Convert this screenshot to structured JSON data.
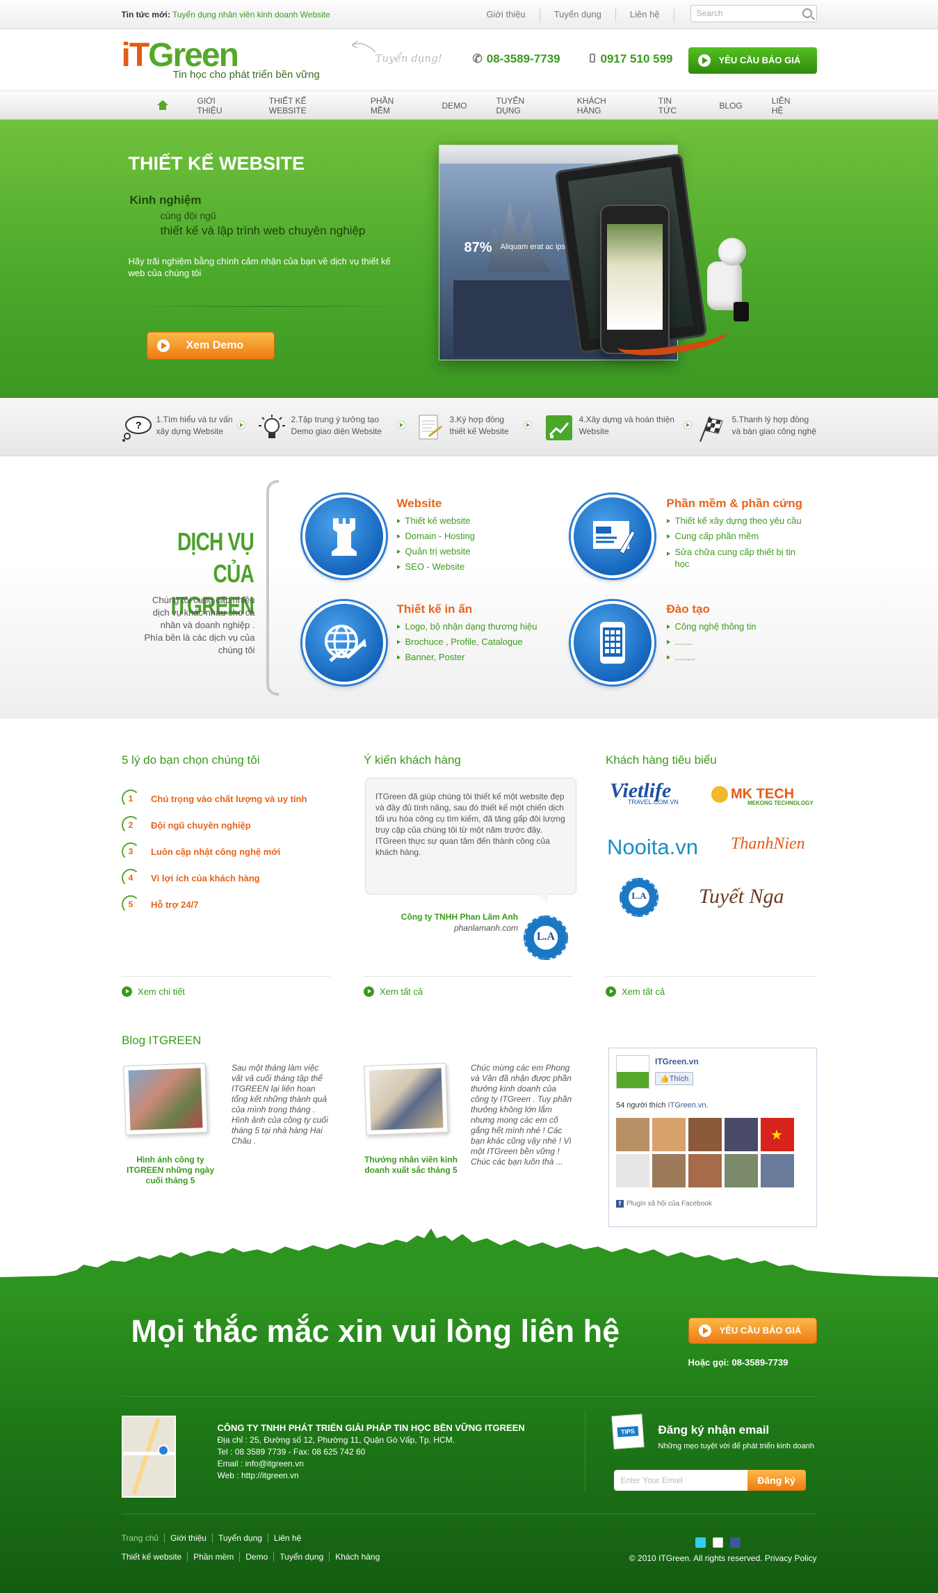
{
  "topbar": {
    "news_prefix": "Tin tức mới:",
    "news_link": "Tuyển dụng nhân viên kinh doanh Website",
    "links": [
      "Giới thiệu",
      "Tuyển dụng",
      "Liên hệ"
    ],
    "search_placeholder": "Search"
  },
  "header": {
    "logo_text_a": "iT",
    "logo_text_b": "Green",
    "tagline": "Tin học cho phát triển bền vững",
    "hand_note": "Tuyển dụng!",
    "phone1": "08-3589-7739",
    "phone2": "0917 510 599",
    "quote_button": "YÊU CẦU BÁO GIÁ"
  },
  "nav": {
    "items": [
      "GIỚI THIỆU",
      "THIẾT KẾ WEBSITE",
      "PHẦN MỀM",
      "DEMO",
      "TUYỂN DỤNG",
      "KHÁCH HÀNG",
      "TIN TỨC",
      "BLOG",
      "LIÊN HỆ"
    ]
  },
  "hero": {
    "title": "THIẾT KẾ WEBSITE",
    "line1": "Kinh nghiệm",
    "line2": "cùng đội ngũ",
    "line3": "thiết kế và lập trình web chuyên nghiệp",
    "paragraph": "Hãy trãi nghiệm bằng chính cảm nhận của bạn về dịch vụ thiết kế web của chúng tôi",
    "demo_button": "Xem Demo",
    "screen_stat": "87%",
    "screen_caption": "Aliquam erat ac ipsum."
  },
  "steps": [
    {
      "line1": "1.Tìm hiểu và tư vấn",
      "line2": "xây dựng Website"
    },
    {
      "line1": "2.Tập trung ý tưởng tạo",
      "line2": "Demo giao diện Website"
    },
    {
      "line1": "3.Ký hợp đồng",
      "line2": "thiết kế Website"
    },
    {
      "line1": "4.Xây dựng và hoàn thiện",
      "line2": "Website"
    },
    {
      "line1": "5.Thanh lý hợp đồng",
      "line2": "và bàn giao công nghệ"
    }
  ],
  "services": {
    "title_line1": "DỊCH VỤ CỦA",
    "title_line2": "ITGREEN",
    "description": "Chúng tôi cung cấp nhiều dịch vụ khác nhau cho cá nhân và doanh nghiệp . Phía bên là các dịch vụ của chúng tôi",
    "items": [
      {
        "title": "Website",
        "list": [
          "Thiết kế website",
          "Domain - Hosting",
          "Quản trị website",
          "SEO - Website"
        ]
      },
      {
        "title": "Phần mềm & phần cứng",
        "list": [
          "Thiết kế xây dựng theo yêu cầu",
          "Cung cấp phần mềm",
          "Sửa chữa cung cấp thiết bị tin học"
        ]
      },
      {
        "title": "Thiết kế in ấn",
        "list": [
          "Logo, bộ nhận dạng thương hiệu",
          "Brochuce , Profile, Catalogue",
          "Banner, Poster"
        ]
      },
      {
        "title": "Đào tạo",
        "list": [
          "Công nghệ thông tin",
          ".......",
          "........"
        ]
      }
    ]
  },
  "reasons": {
    "heading": "5 lý do bạn chọn chúng tôi",
    "items": [
      "Chú trọng vào chất lượng và uy tính",
      "Đội ngũ chuyên nghiệp",
      "Luôn cập nhật công nghệ mới",
      "Vì lợi ích của khách hàng",
      "Hỗ trợ 24/7"
    ],
    "more": "Xem chi tiết"
  },
  "testimonial": {
    "heading": "Ý kiến khách hàng",
    "text": "ITGreen đã giúp chúng tôi thiết kế một website đẹp và đầy đủ tính năng, sau đó thiết kế một chiến dịch tối ưu hóa công cụ tìm kiếm, đã tăng gấp đôi lượng truy cập của chúng tôi từ một năm trước đây. ITGreen thực sự quan tâm đến thành công của khách hàng.",
    "company": "Công ty TNHH Phan Lâm Anh",
    "site": "phanlamanh.com",
    "seal": "L.A",
    "more": "Xem tất cả"
  },
  "clients": {
    "heading": "Khách hàng tiêu biểu",
    "logos": [
      "Vietlife",
      "TRAVEL.COM.VN",
      "MK TECH",
      "MEKONG TECHNOLOGY",
      "Nooita.vn",
      "ThanhNien",
      "L.A",
      "Tuyết Nga"
    ],
    "more": "Xem tất cả"
  },
  "blog": {
    "heading": "Blog ITGREEN",
    "posts": [
      {
        "caption": "Hình ảnh công ty ITGREEN những ngày cuối tháng 5",
        "excerpt": "Sau một tháng làm việc vất vả cuối tháng tập thể ITGREEN lại liên hoan tổng kết những thành quả của mình trong tháng . Hình ảnh của công ty cuối tháng 5 tại nhà hàng Hai Châu ."
      },
      {
        "caption": "Thưởng nhân viên kinh doanh xuất sắc tháng 5",
        "excerpt": "Chúc mừng các em Phong và Vân đã nhận được phần thưởng kinh doanh của công ty ITGreen . Tuy phần thưởng không lớn lắm nhưng mong các em cố gắng hết mình nhé ! Các bạn khác cũng vậy nhé ! Vì một ITGreen bền vững ! Chúc các bạn luôn thà ..."
      }
    ]
  },
  "facebook": {
    "page": "ITGreen.vn",
    "like": "Thích",
    "count_text": "54 người thích",
    "count_link": "ITGreen.vn",
    "plugin": "Plugin xã hội của Facebook"
  },
  "footer": {
    "cta": "Mọi thắc mắc xin vui lòng liên hệ",
    "quote_button": "YÊU CẦU BÁO GIÁ",
    "hotline": "Hoặc gọi: 08-3589-7739",
    "company": "CÔNG TY TNHH PHÁT TRIỂN GIẢI PHÁP TIN HỌC BỀN VỮNG ITGREEN",
    "address": "Địa chỉ : 25, Đường số 12, Phường 11, Quận Gò Vấp, Tp. HCM.",
    "tel": "Tel : 08 3589 7739 - Fax: 08 625 742 60",
    "email": "Email : info@itgreen.vn",
    "web": "Web : http://itgreen.vn",
    "newsletter_title": "Đăng ký nhận email",
    "newsletter_sub": "Những mẹo tuyệt vời để phát triển kinh doanh",
    "email_placeholder": "Enter Your Email",
    "subscribe": "Đăng ký",
    "tips": "TIPS",
    "links1": [
      "Trang chủ",
      "Giới thiệu",
      "Tuyển dụng",
      "Liên hệ"
    ],
    "links2": [
      "Thiết kế website",
      "Phần mềm",
      "Demo",
      "Tuyển dụng",
      "Khách hàng"
    ],
    "copyright": "© 2010 ITGreen. All rights reserved.",
    "privacy": "Privacy Policy"
  }
}
